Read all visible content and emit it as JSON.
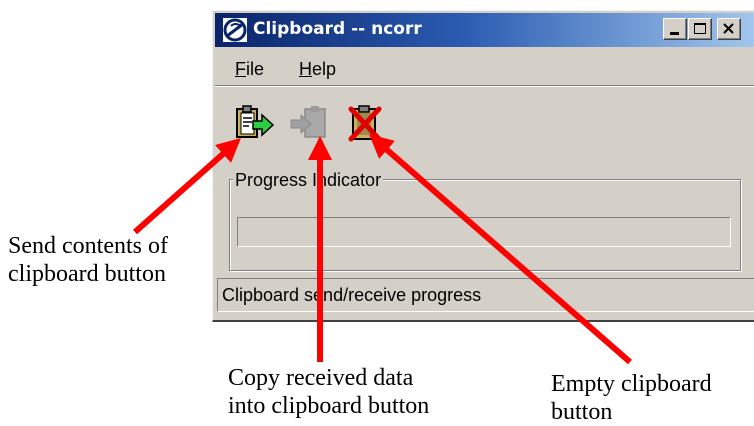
{
  "window": {
    "title": "Clipboard -- ncorr",
    "controls": [
      "minimize",
      "maximize",
      "close"
    ]
  },
  "menu": {
    "file": {
      "mnemonic": "F",
      "rest": "ile"
    },
    "help": {
      "mnemonic": "H",
      "rest": "elp"
    }
  },
  "toolbar": {
    "buttons": [
      {
        "icon": "clipboard-send-icon",
        "enabled": true
      },
      {
        "icon": "clipboard-receive-icon",
        "enabled": false
      },
      {
        "icon": "empty-clipboard-icon",
        "enabled": true
      }
    ]
  },
  "progress": {
    "group_label": "Progress Indicator",
    "value": 0
  },
  "status": {
    "text": "Clipboard send/receive progress"
  },
  "annotations": {
    "send": {
      "line1": "Send contents of",
      "line2": "clipboard button"
    },
    "copy": {
      "line1": "Copy received data",
      "line2": "into clipboard button"
    },
    "empty": {
      "line1": "Empty clipboard",
      "line2": "button"
    }
  },
  "colors": {
    "arrow": "#ff0000",
    "titlebar_start": "#0a246a",
    "titlebar_end": "#a6caf0",
    "window_face": "#d4d0c8"
  }
}
